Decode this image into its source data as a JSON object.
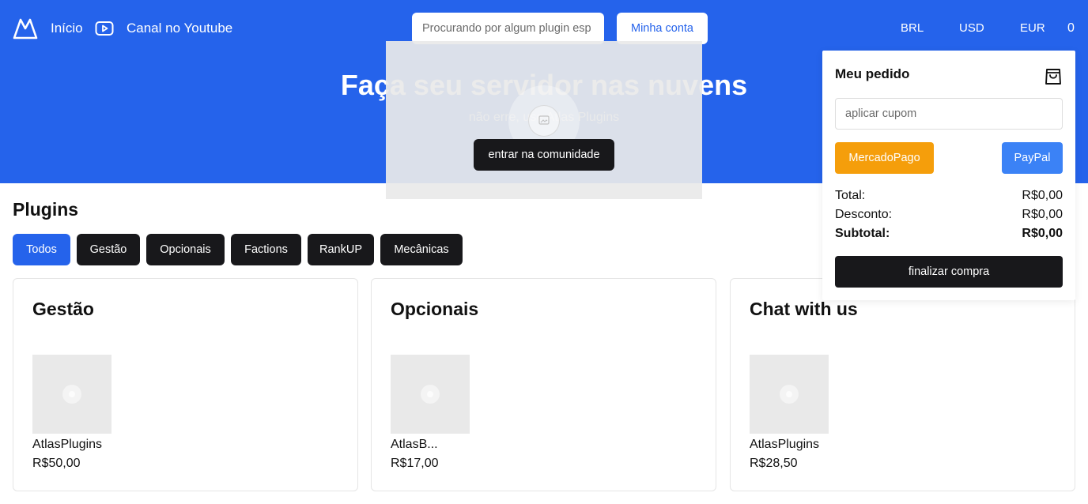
{
  "header": {
    "logo_icon": "atlas-mountain-logo",
    "nav": [
      {
        "label": "Início",
        "icon": null
      },
      {
        "label": "Canal no Youtube",
        "icon": "youtube-play-icon"
      }
    ],
    "search": {
      "placeholder": "Procurando por algum plugin esp",
      "value": ""
    },
    "account_label": "Minha conta",
    "currencies": [
      "BRL",
      "USD",
      "EUR"
    ],
    "cart_count": "0"
  },
  "hero": {
    "title": "Faça seu servidor nas nuvens",
    "subtitle": "não erre, use Atlas Plugins",
    "cta_label": "entrar na comunidade"
  },
  "plugins": {
    "title": "Plugins",
    "tabs": [
      {
        "label": "Todos",
        "active": true
      },
      {
        "label": "Gestão",
        "active": false
      },
      {
        "label": "Opcionais",
        "active": false
      },
      {
        "label": "Factions",
        "active": false
      },
      {
        "label": "RankUP",
        "active": false
      },
      {
        "label": "Mecânicas",
        "active": false
      }
    ],
    "cards": [
      {
        "title": "Gestão",
        "product": {
          "name": "AtlasPlugins",
          "price": "R$50,00"
        }
      },
      {
        "title": "Opcionais",
        "product": {
          "name": "AtlasB...",
          "price": "R$17,00"
        }
      },
      {
        "title": "Chat with us",
        "product": {
          "name": "AtlasPlugins",
          "price": "R$28,50"
        }
      }
    ]
  },
  "order": {
    "title": "Meu pedido",
    "icon": "shopping-bag-icon",
    "coupon_placeholder": "aplicar cupom",
    "payment": {
      "mercadopago": "MercadoPago",
      "paypal": "PayPal"
    },
    "rows": [
      {
        "label": "Total:",
        "value": "R$0,00"
      },
      {
        "label": "Desconto:",
        "value": "R$0,00"
      },
      {
        "label": "Subtotal:",
        "value": "R$0,00"
      }
    ],
    "checkout_label": "finalizar compra"
  },
  "colors": {
    "primary": "#2563eb",
    "dark_button": "#18181b",
    "mercadopago": "#f59e0b",
    "paypal": "#3b82f6"
  }
}
